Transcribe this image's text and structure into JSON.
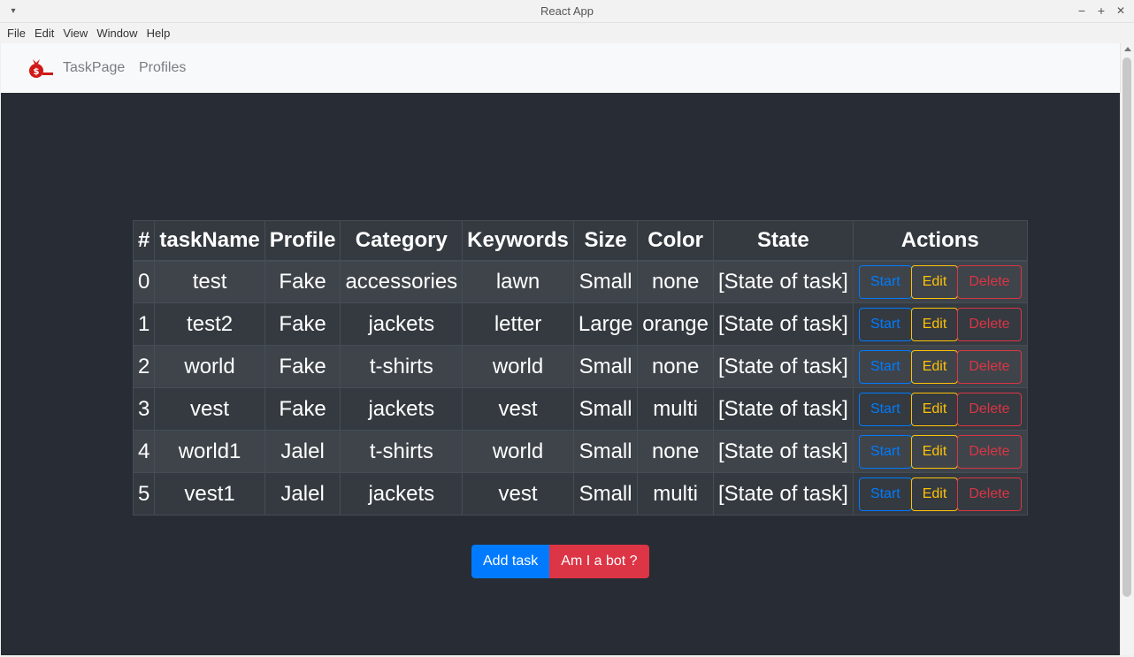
{
  "window": {
    "title": "React App",
    "controls": {
      "minimize": "−",
      "maximize": "+",
      "close": "✕"
    }
  },
  "menubar": {
    "items": [
      "File",
      "Edit",
      "View",
      "Window",
      "Help"
    ]
  },
  "navbar": {
    "logo_icon": "money-bag-icon",
    "links": [
      "TaskPage",
      "Profiles"
    ]
  },
  "table": {
    "headers": [
      "#",
      "taskName",
      "Profile",
      "Category",
      "Keywords",
      "Size",
      "Color",
      "State",
      "Actions"
    ],
    "rows": [
      {
        "index": "0",
        "taskName": "test",
        "profile": "Fake",
        "category": "accessories",
        "keywords": "lawn",
        "size": "Small",
        "color": "none",
        "state": "[State of task]"
      },
      {
        "index": "1",
        "taskName": "test2",
        "profile": "Fake",
        "category": "jackets",
        "keywords": "letter",
        "size": "Large",
        "color": "orange",
        "state": "[State of task]"
      },
      {
        "index": "2",
        "taskName": "world",
        "profile": "Fake",
        "category": "t-shirts",
        "keywords": "world",
        "size": "Small",
        "color": "none",
        "state": "[State of task]"
      },
      {
        "index": "3",
        "taskName": "vest",
        "profile": "Fake",
        "category": "jackets",
        "keywords": "vest",
        "size": "Small",
        "color": "multi",
        "state": "[State of task]"
      },
      {
        "index": "4",
        "taskName": "world1",
        "profile": "Jalel",
        "category": "t-shirts",
        "keywords": "world",
        "size": "Small",
        "color": "none",
        "state": "[State of task]"
      },
      {
        "index": "5",
        "taskName": "vest1",
        "profile": "Jalel",
        "category": "jackets",
        "keywords": "vest",
        "size": "Small",
        "color": "multi",
        "state": "[State of task]"
      }
    ],
    "actions": {
      "start": "Start",
      "edit": "Edit",
      "delete": "Delete"
    }
  },
  "buttons": {
    "add_task": "Add task",
    "bot": "Am I a bot ?"
  },
  "colors": {
    "background": "#282c34",
    "primary": "#007bff",
    "warning": "#ffc107",
    "danger": "#dc3545",
    "table_dark": "#343a40"
  }
}
